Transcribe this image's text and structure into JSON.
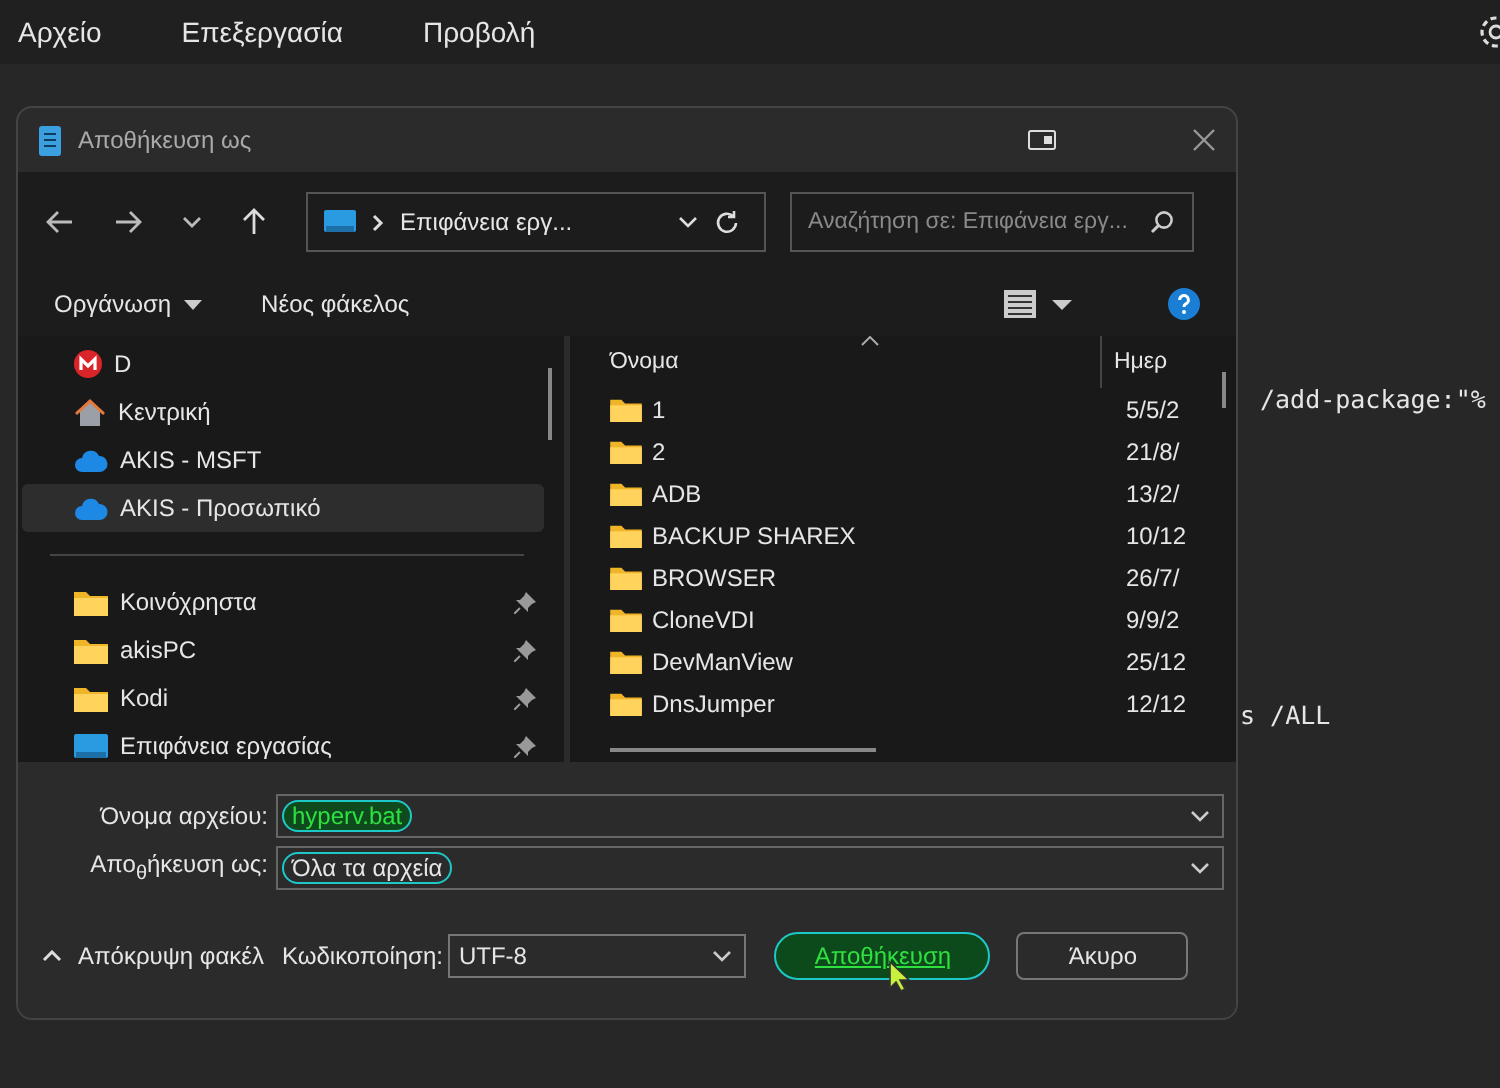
{
  "menu": [
    "Αρχείο",
    "Επεξεργασία",
    "Προβολή"
  ],
  "editor_lines": [
    "/add-package:\"%",
    "s /ALL"
  ],
  "dialog": {
    "title": "Αποθήκευση ως",
    "path": "Επιφάνεια εργ...",
    "search": {
      "placeholder": "Αναζήτηση σε: Επιφάνεια εργ..."
    },
    "toolbar": [
      "Οργάνωση",
      "Νέος φάκελος"
    ],
    "sidebar": [
      {
        "label": "D",
        "kind": "drive",
        "selected": false,
        "pinned": false
      },
      {
        "label": "Κεντρική",
        "kind": "home",
        "selected": false,
        "pinned": false
      },
      {
        "label": "AKIS - MSFT",
        "kind": "cloud",
        "selected": false,
        "pinned": false
      },
      {
        "label": "AKIS - Προσωπικό",
        "kind": "cloud",
        "selected": true,
        "pinned": false
      },
      {
        "kind": "divider"
      },
      {
        "label": "Κοινόχρηστα",
        "kind": "folder",
        "selected": false,
        "pinned": true
      },
      {
        "label": "akisPC",
        "kind": "folder",
        "selected": false,
        "pinned": true
      },
      {
        "label": "Kodi",
        "kind": "folder",
        "selected": false,
        "pinned": true
      },
      {
        "label": "Επιφάνεια εργασίας",
        "kind": "desktop",
        "selected": false,
        "pinned": true
      }
    ],
    "columns": [
      "Όνομα",
      "Ημερ"
    ],
    "files": [
      {
        "name": "1",
        "date": "5/5/2"
      },
      {
        "name": "2",
        "date": "21/8/"
      },
      {
        "name": "ADB",
        "date": "13/2/"
      },
      {
        "name": "BACKUP SHAREX",
        "date": "10/12"
      },
      {
        "name": "BROWSER",
        "date": "26/7/"
      },
      {
        "name": "CloneVDI",
        "date": "9/9/2"
      },
      {
        "name": "DevManView",
        "date": "25/12"
      },
      {
        "name": "DnsJumper",
        "date": "12/12"
      }
    ],
    "filename_label": "Όνομα αρχείου:",
    "filename": "hyperv.bat",
    "type_label": "Απο$_{θ}$ήκευση ως:",
    "type": "Όλα τα αρχεία",
    "hide_folders": "Απόκρυψη φακέλ",
    "encoding_label": "Κωδικοποίηση:",
    "encoding": "UTF-8",
    "save": "Αποθήκευση",
    "cancel": "Άκυρο"
  }
}
